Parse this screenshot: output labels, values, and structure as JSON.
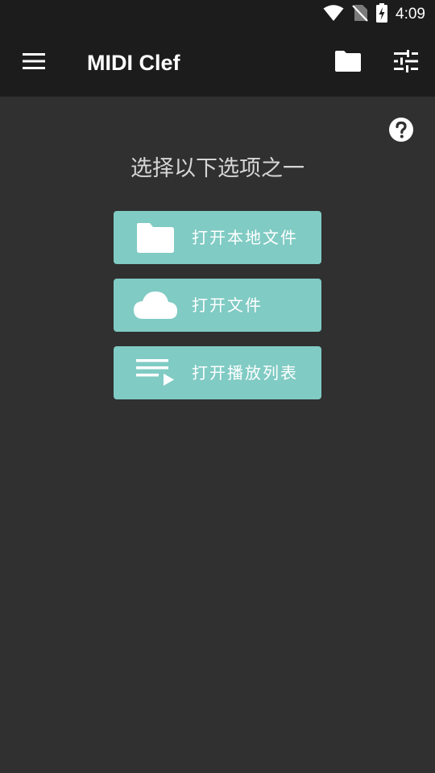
{
  "status_bar": {
    "time": "4:09",
    "icons": [
      "wifi-icon",
      "no-sim-icon",
      "battery-charging-icon"
    ]
  },
  "app_bar": {
    "title": "MIDI Clef",
    "icons": [
      "menu-icon",
      "folder-icon",
      "tune-icon"
    ]
  },
  "main": {
    "heading": "选择以下选项之一",
    "help_icon": "help-icon",
    "options": [
      {
        "label": "打开本地文件",
        "icon": "folder-icon"
      },
      {
        "label": "打开文件",
        "icon": "cloud-icon"
      },
      {
        "label": "打开播放列表",
        "icon": "playlist-play-icon"
      }
    ]
  },
  "colors": {
    "background": "#303030",
    "app_bar": "#1c1c1c",
    "button": "#80cbc4",
    "heading_text": "#d6d6d6",
    "white": "#ffffff"
  }
}
